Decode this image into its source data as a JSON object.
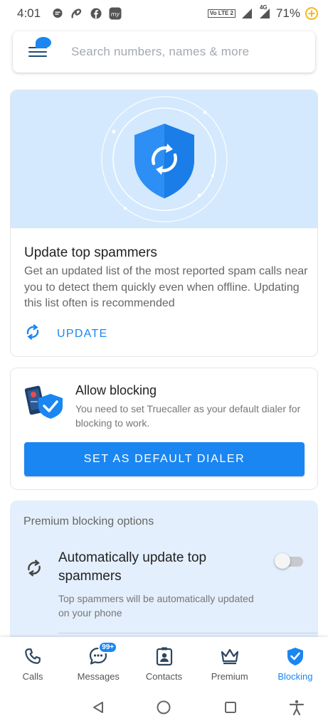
{
  "status_bar": {
    "time": "4:01",
    "battery_percent": "71%",
    "network_badge": "4G",
    "volte_label": "Vo LTE 2",
    "icons": [
      "chat-icon",
      "airtel-icon",
      "facebook-icon",
      "myjio-icon",
      "volte-icon",
      "network-signal-icon",
      "signal-icon",
      "battery-saver-icon"
    ]
  },
  "search": {
    "placeholder": "Search numbers, names & more"
  },
  "update_card": {
    "title": "Update top spammers",
    "description": "Get an updated list of the most reported spam calls near you to detect them quickly even when offline. Updating this list often is recommended",
    "action_label": "UPDATE"
  },
  "allow_card": {
    "title": "Allow blocking",
    "description": "You need to set Truecaller as your default dialer for blocking to work.",
    "button_label": "SET AS DEFAULT DIALER"
  },
  "premium_card": {
    "section_title": "Premium blocking options",
    "option_title": "Automatically update top spammers",
    "option_description": "Top spammers will be automatically updated on your phone",
    "toggle_on": false
  },
  "bottom_nav": {
    "items": [
      {
        "label": "Calls",
        "icon": "phone-icon",
        "active": false
      },
      {
        "label": "Messages",
        "icon": "messages-icon",
        "badge": "99+",
        "active": false
      },
      {
        "label": "Contacts",
        "icon": "contacts-icon",
        "active": false
      },
      {
        "label": "Premium",
        "icon": "crown-icon",
        "active": false
      },
      {
        "label": "Blocking",
        "icon": "shield-check-icon",
        "active": true
      }
    ]
  },
  "colors": {
    "accent": "#1a86f2",
    "hero_bg": "#d4e9fd",
    "premium_bg": "#e3effc"
  }
}
